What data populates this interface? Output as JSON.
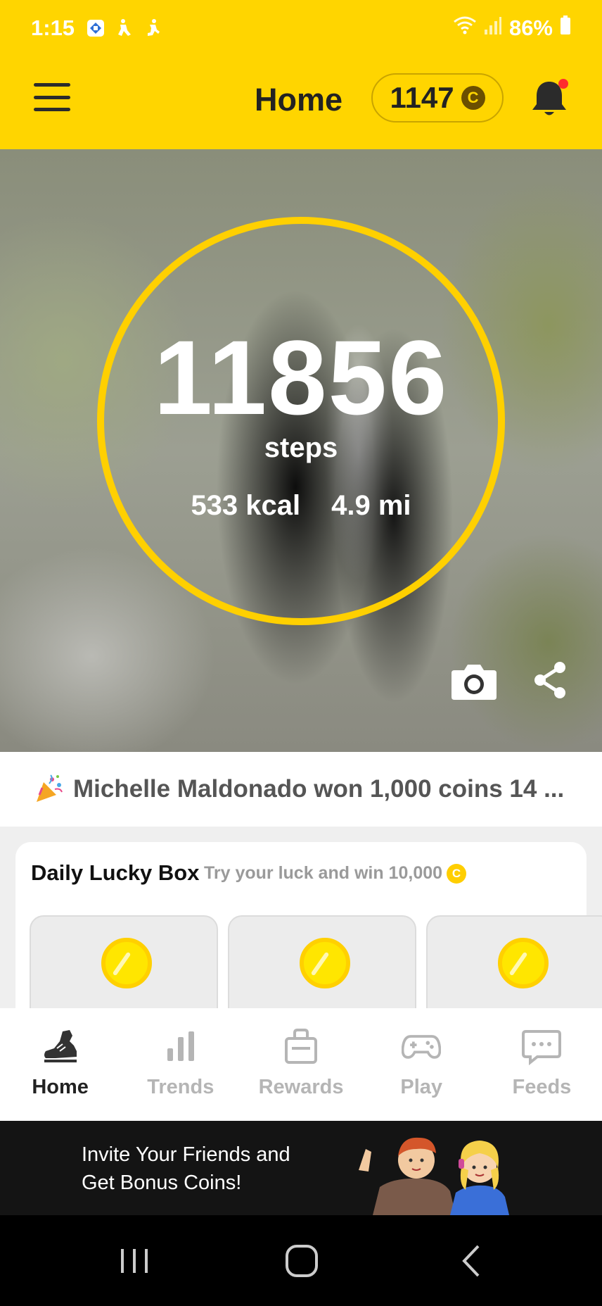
{
  "status_bar": {
    "time": "1:15",
    "battery": "86%"
  },
  "header": {
    "title": "Home",
    "coins": "1147",
    "coin_symbol": "C"
  },
  "hero": {
    "steps": "11856",
    "steps_label": "steps",
    "calories": "533 kcal",
    "distance": "4.9 mi"
  },
  "ticker": {
    "text": "Michelle Maldonado won 1,000 coins 14 ..."
  },
  "lucky_box": {
    "title": "Daily Lucky Box",
    "subtitle": "Try your luck and win 10,000",
    "coin_symbol": "C"
  },
  "nav": {
    "items": [
      {
        "label": "Home",
        "icon": "sneaker-icon",
        "active": true
      },
      {
        "label": "Trends",
        "icon": "bar-chart-icon",
        "active": false
      },
      {
        "label": "Rewards",
        "icon": "shopping-bag-icon",
        "active": false
      },
      {
        "label": "Play",
        "icon": "gamepad-icon",
        "active": false
      },
      {
        "label": "Feeds",
        "icon": "chat-bubble-icon",
        "active": false
      }
    ]
  },
  "invite": {
    "line1": "Invite Your Friends and",
    "line2": "Get Bonus Coins!"
  },
  "colors": {
    "brand_yellow": "#FFD500",
    "ring": "#FFD000",
    "notification": "#FF2D2D"
  }
}
